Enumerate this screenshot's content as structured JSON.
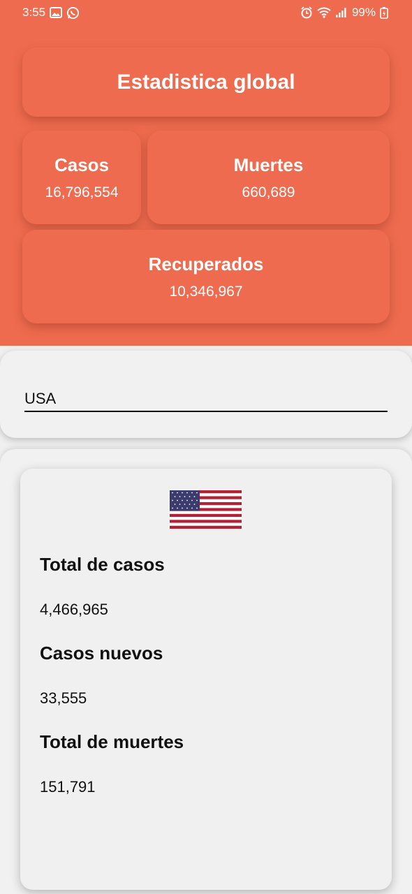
{
  "status_bar": {
    "time": "3:55",
    "battery": "99%",
    "left_icons": [
      "image-icon",
      "whatsapp-icon"
    ],
    "right_icons": [
      "alarm-icon",
      "wifi-icon",
      "signal-icon",
      "battery-icon"
    ]
  },
  "colors": {
    "accent": "#ef6b4f",
    "background": "#f0f0f0",
    "text_dark": "#111111",
    "text_light": "#ffffff"
  },
  "global": {
    "title": "Estadistica global",
    "cases": {
      "label": "Casos",
      "value": "16,796,554"
    },
    "deaths": {
      "label": "Muertes",
      "value": "660,689"
    },
    "recovered": {
      "label": "Recuperados",
      "value": "10,346,967"
    }
  },
  "search": {
    "value": "USA"
  },
  "country": {
    "flag": "us-flag-icon",
    "stats": [
      {
        "label": "Total de casos",
        "value": "4,466,965"
      },
      {
        "label": "Casos nuevos",
        "value": "33,555"
      },
      {
        "label": "Total de muertes",
        "value": "151,791"
      }
    ]
  }
}
